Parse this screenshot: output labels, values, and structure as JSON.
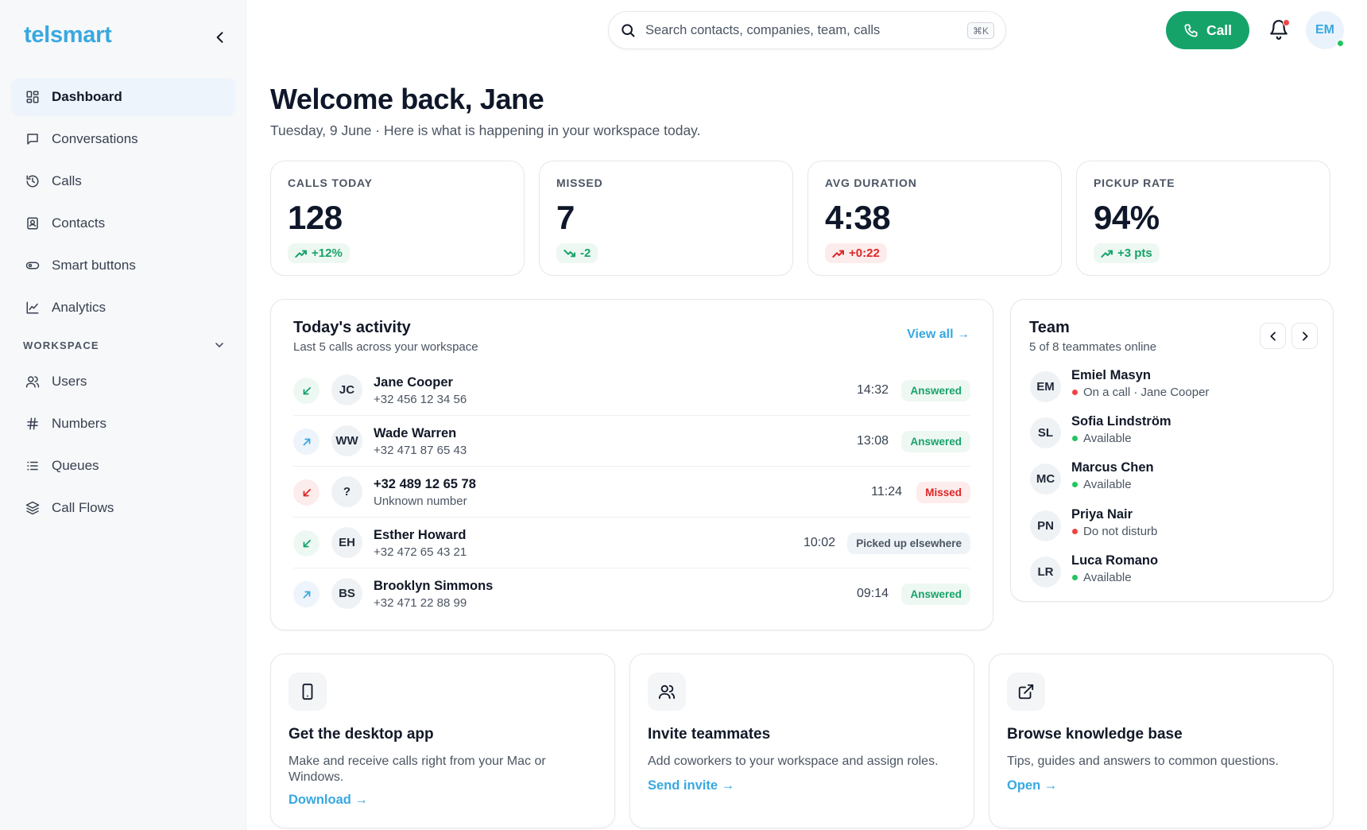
{
  "app": {
    "name": "telsmart"
  },
  "sidebar": {
    "items": [
      {
        "label": "Dashboard",
        "icon": "dashboard-icon",
        "active": true
      },
      {
        "label": "Conversations",
        "icon": "chat-icon"
      },
      {
        "label": "Calls",
        "icon": "history-icon"
      },
      {
        "label": "Contacts",
        "icon": "contact-card-icon"
      },
      {
        "label": "Smart buttons",
        "icon": "toggle-icon"
      },
      {
        "label": "Analytics",
        "icon": "chart-icon"
      }
    ],
    "section_label": "WORKSPACE",
    "workspace_items": [
      {
        "label": "Users",
        "icon": "users-icon"
      },
      {
        "label": "Numbers",
        "icon": "hash-icon"
      },
      {
        "label": "Queues",
        "icon": "list-icon"
      },
      {
        "label": "Call Flows",
        "icon": "layers-icon"
      }
    ]
  },
  "topbar": {
    "search_placeholder": "Search contacts, companies, team, calls",
    "search_shortcut": "⌘K",
    "call_label": "Call",
    "user_initials": "EM"
  },
  "header": {
    "title": "Welcome back, Jane",
    "subtitle": "Tuesday, 9 June · Here is what is happening in your workspace today."
  },
  "stats": [
    {
      "label": "CALLS TODAY",
      "value": "128",
      "delta": "+12%",
      "trend": "good"
    },
    {
      "label": "MISSED",
      "value": "7",
      "delta": "-2",
      "trend": "good"
    },
    {
      "label": "AVG DURATION",
      "value": "4:38",
      "delta": "+0:22",
      "trend": "bad"
    },
    {
      "label": "PICKUP RATE",
      "value": "94%",
      "delta": "+3 pts",
      "trend": "good"
    }
  ],
  "activity": {
    "title": "Today's activity",
    "subtitle": "Last 5 calls across your workspace",
    "view_all": "View all →",
    "rows": [
      {
        "direction": "incoming",
        "initials": "JC",
        "name": "Jane Cooper",
        "phone": "+32 456 12 34 56",
        "time": "14:32",
        "status": "Answered",
        "status_type": "answered"
      },
      {
        "direction": "outgoing",
        "initials": "WW",
        "name": "Wade Warren",
        "phone": "+32 471 87 65 43",
        "time": "13:08",
        "status": "Answered",
        "status_type": "answered"
      },
      {
        "direction": "missed",
        "initials": "?",
        "name": "+32 489 12 65 78",
        "phone": "Unknown number",
        "time": "11:24",
        "status": "Missed",
        "status_type": "missed"
      },
      {
        "direction": "incoming",
        "initials": "EH",
        "name": "Esther Howard",
        "phone": "+32 472 65 43 21",
        "time": "10:02",
        "status": "Picked up elsewhere",
        "status_type": "elsewhere"
      },
      {
        "direction": "outgoing",
        "initials": "BS",
        "name": "Brooklyn Simmons",
        "phone": "+32 471 22 88 99",
        "time": "09:14",
        "status": "Answered",
        "status_type": "answered"
      }
    ]
  },
  "team": {
    "title": "Team",
    "subtitle": "5 of 8 teammates online",
    "members": [
      {
        "initials": "EM",
        "name": "Emiel Masyn",
        "status": "On a call · Jane Cooper",
        "color": "#ef4444"
      },
      {
        "initials": "SL",
        "name": "Sofia Lindström",
        "status": "Available",
        "color": "#22c55e"
      },
      {
        "initials": "MC",
        "name": "Marcus Chen",
        "status": "Available",
        "color": "#22c55e"
      },
      {
        "initials": "PN",
        "name": "Priya Nair",
        "status": "Do not disturb",
        "color": "#ef4444"
      },
      {
        "initials": "LR",
        "name": "Luca Romano",
        "status": "Available",
        "color": "#22c55e"
      }
    ]
  },
  "cards": [
    {
      "icon": "phone-device-icon",
      "title": "Get the desktop app",
      "description": "Make and receive calls right from your Mac or Windows.",
      "link": "Download →"
    },
    {
      "icon": "users-icon",
      "title": "Invite teammates",
      "description": "Add coworkers to your workspace and assign roles.",
      "link": "Send invite →"
    },
    {
      "icon": "external-link-icon",
      "title": "Browse knowledge base",
      "description": "Tips, guides and answers to common questions.",
      "link": "Open →"
    }
  ],
  "colors": {
    "brand": "#38a8e0",
    "call_button": "#16a36a",
    "success": "#16a36a",
    "danger": "#dc2626"
  }
}
